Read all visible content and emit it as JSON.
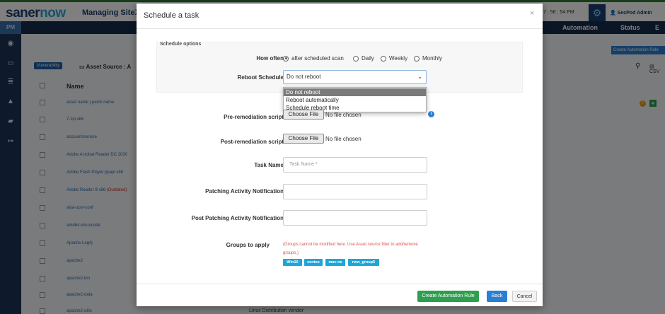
{
  "app": {
    "logo_a": "saner",
    "logo_b": "now",
    "managing": "Managing",
    "site": "SiteX",
    "time": "7 : 56 : 54 PM",
    "user": "SecPod Admin"
  },
  "nav": {
    "pm": "PM",
    "automation": "Automation",
    "status": "Status"
  },
  "background": {
    "vulnerability_chip": "Vulnerability",
    "asset_source": "Asset Source :",
    "asset_source_value": "A",
    "create_rule": "Create Automation Rule",
    "csv": "CSV",
    "name_header": "Name",
    "rows": [
      "asset name | patch name",
      "7-zip x86",
      "accountsservice",
      "Adobe Acrobat Reader DC 2020",
      "Adobe Flash Player ppapi x86",
      "Adobe Reader 9 x86",
      "alsa-ucm-conf",
      "amd64-microcode",
      "Apache Log4j",
      "apache2",
      "apache2-bin",
      "apache2-data",
      "apache2-utils"
    ],
    "outdated": "(Outdated)",
    "distro_vendor": "Linux Distribution vendor"
  },
  "modal": {
    "title": "Schedule a task",
    "close": "×",
    "schedule_options": "Schedule options",
    "how_often_label": "How often",
    "how_often_options": [
      "after scheduled scan",
      "Daily",
      "Weekly",
      "Monthly"
    ],
    "how_often_selected": "after scheduled scan",
    "reboot_label": "Reboot Schedule",
    "reboot_value": "Do not reboot",
    "reboot_options": [
      "Do not reboot",
      "Reboot automatically",
      "Schedule reboot time"
    ],
    "pre_label": "Pre-remediation script",
    "post_label": "Post-remediation script",
    "choose_file": "Choose File",
    "no_file": "No file chosen",
    "task_name_label": "Task Name",
    "task_name_placeholder": "Task Name *",
    "patching_notif_label": "Patching Activity Notification",
    "post_patching_notif_label": "Post Patching Activity Notification",
    "groups_label": "Groups to apply",
    "groups_note": "(Groups cannot be modified here. Use Asset source filter to add/remove groups.)",
    "groups": [
      "Win10",
      "centos",
      "mac os",
      "new_group5"
    ],
    "btn_create": "Create Automation Rule",
    "btn_back": "Back",
    "btn_cancel": "Cancel"
  }
}
